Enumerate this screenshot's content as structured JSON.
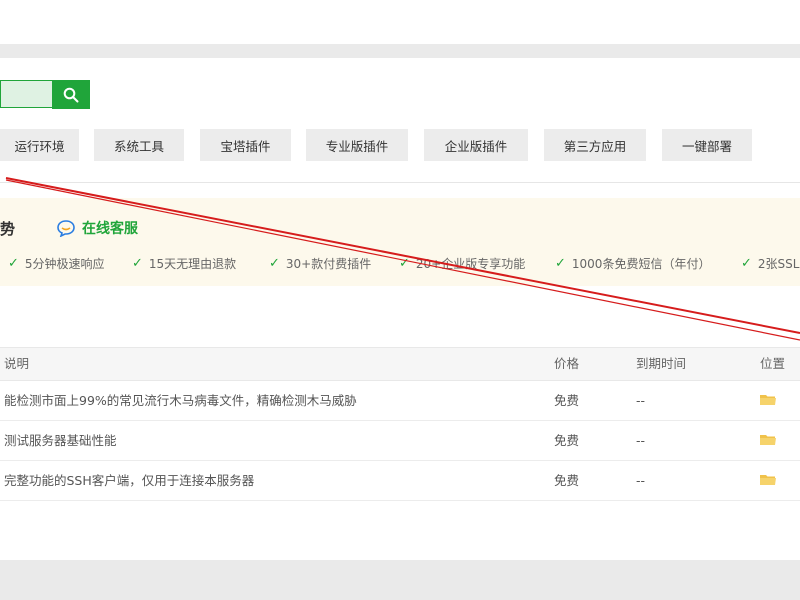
{
  "categories": [
    "运行环境",
    "系统工具",
    "宝塔插件",
    "专业版插件",
    "企业版插件",
    "第三方应用",
    "一键部署"
  ],
  "advantage": {
    "title": "势",
    "online_service": "在线客服",
    "features": [
      "5分钟极速响应",
      "15天无理由退款",
      "30+款付费插件",
      "20+企业版专享功能",
      "1000条免费短信（年付）",
      "2张SSL"
    ]
  },
  "table": {
    "headers": {
      "desc": "说明",
      "price": "价格",
      "expire": "到期时间",
      "location": "位置"
    },
    "rows": [
      {
        "desc": "能检测市面上99%的常见流行木马病毒文件，精确检测木马威胁",
        "price": "免费",
        "expire": "--"
      },
      {
        "desc": "测试服务器基础性能",
        "price": "免费",
        "expire": "--"
      },
      {
        "desc": "完整功能的SSH客户端，仅用于连接本服务器",
        "price": "免费",
        "expire": "--"
      }
    ]
  },
  "colors": {
    "accent": "#20a53a",
    "folder": "#f0c24b",
    "annotation": "#d61c1c"
  },
  "icons": {
    "search": "search-icon",
    "service": "chat-bubble-icon",
    "check": "check-icon",
    "folder": "folder-icon"
  }
}
